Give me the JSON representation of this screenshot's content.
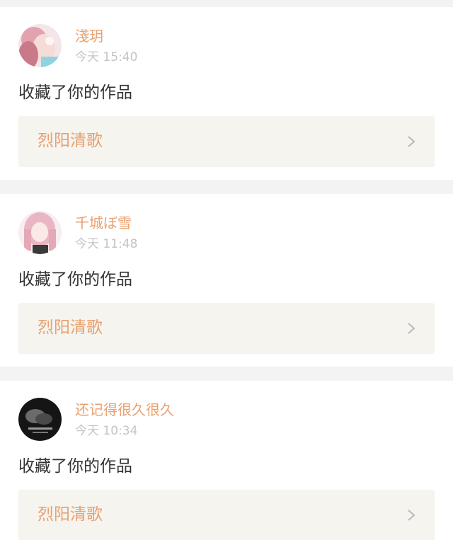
{
  "notifications": [
    {
      "username": "淺玥",
      "time": "今天 15:40",
      "action": "收藏了你的作品",
      "work_title": "烈阳清歌",
      "avatar_icon": "avatar-pink-haired-girl"
    },
    {
      "username": "千城ぼ雪",
      "time": "今天 11:48",
      "action": "收藏了你的作品",
      "work_title": "烈阳清歌",
      "avatar_icon": "avatar-anime-girl-pink"
    },
    {
      "username": "还记得很久很久",
      "time": "今天 10:34",
      "action": "收藏了你的作品",
      "work_title": "烈阳清歌",
      "avatar_icon": "avatar-dark-photo"
    }
  ],
  "colors": {
    "accent": "#e8a170",
    "time": "#c4c4c4",
    "text": "#333333",
    "work_box_bg": "#f5f4ef",
    "page_bg": "#f4f3f3"
  }
}
